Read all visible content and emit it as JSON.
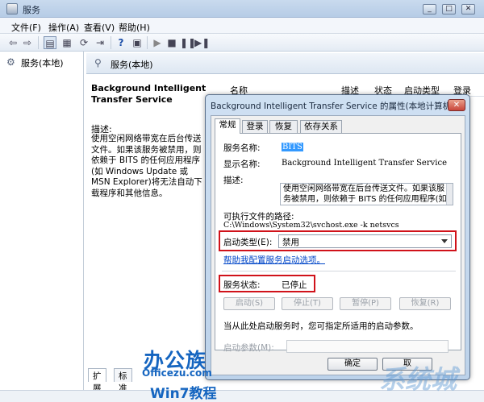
{
  "window": {
    "title": "服务"
  },
  "caption_buttons": [
    "_",
    "□",
    "✕"
  ],
  "menu": [
    "文件(F)",
    "操作(A)",
    "查看(V)",
    "帮助(H)"
  ],
  "left_pane": {
    "node_label": "服务(本地)"
  },
  "right_pane": {
    "header_label": "服务(本地)",
    "service_title": "Background Intelligent Transfer Service",
    "desc_label": "描述:",
    "desc_text": "使用空闲网络带宽在后台传送文件。如果该服务被禁用，则依赖于 BITS 的任何应用程序(如 Windows Update 或 MSN Explorer)将无法自动下载程序和其他信息。",
    "columns": [
      "名称",
      "描述",
      "状态",
      "启动类型",
      "登录"
    ],
    "bottom_tabs": [
      "扩展",
      "标准"
    ]
  },
  "dialog": {
    "title": "Background Intelligent Transfer Service 的属性(本地计算机)",
    "close": "✕",
    "tabs": [
      "常规",
      "登录",
      "恢复",
      "依存关系"
    ],
    "service_name_label": "服务名称:",
    "service_name_value": "BITS",
    "display_name_label": "显示名称:",
    "display_name_value": "Background Intelligent Transfer Service",
    "description_label": "描述:",
    "description_value": "使用空闲网络带宽在后台传送文件。如果该服务被禁用，则依赖于 BITS 的任何应用程序(如",
    "exe_path_label": "可执行文件的路径:",
    "exe_path_value": "C:\\Windows\\System32\\svchost.exe -k netsvcs",
    "startup_type_label": "启动类型(E):",
    "startup_type_value": "禁用",
    "help_link": "帮助我配置服务启动选项。",
    "service_status_label": "服务状态:",
    "service_status_value": "已停止",
    "buttons": {
      "start": "启动(S)",
      "stop": "停止(T)",
      "pause": "暂停(P)",
      "resume": "恢复(R)"
    },
    "hint": "当从此处启动服务时，您可指定所适用的启动参数。",
    "start_params_label": "启动参数(M):",
    "ok": "确定",
    "cancel": "取"
  },
  "watermarks": {
    "logo_top": "办公族",
    "logo_url": "Officezu.com",
    "logo_bottom": "Win7教程",
    "right_site": "系统城"
  },
  "colors": {
    "highlight_red": "#d0121a",
    "selection_blue": "#3399ff",
    "link": "#0046c8"
  }
}
